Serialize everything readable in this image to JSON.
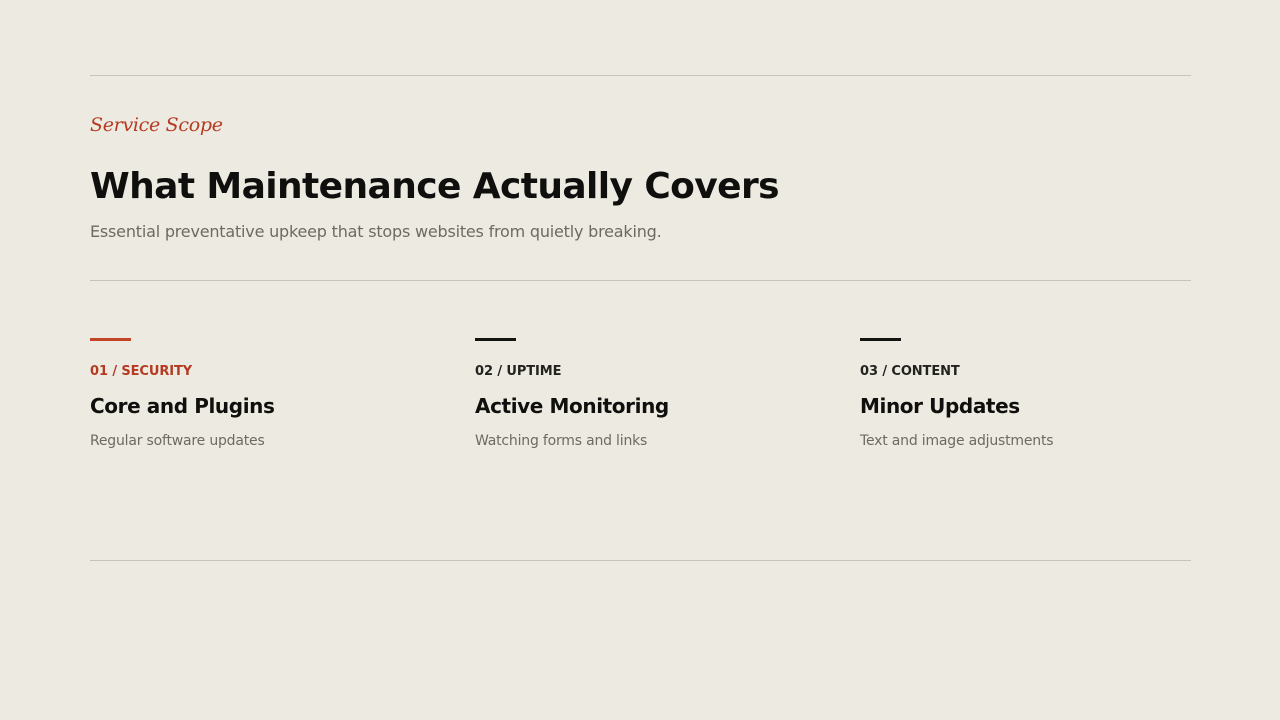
{
  "header": {
    "eyebrow": "Service Scope",
    "title": "What Maintenance Actually Covers",
    "subtitle": "Essential preventative upkeep that stops websites from quietly breaking."
  },
  "colors": {
    "background": "#EDEAE1",
    "accent": "#B53A22",
    "text": "#0F0F0D",
    "muted": "#6E6A62",
    "rule": "#C8C4BA"
  },
  "cards": [
    {
      "tag": "01 / SECURITY",
      "heading": "Core and Plugins",
      "description": "Regular software updates"
    },
    {
      "tag": "02 / UPTIME",
      "heading": "Active Monitoring",
      "description": "Watching forms and links"
    },
    {
      "tag": "03 / CONTENT",
      "heading": "Minor Updates",
      "description": "Text and image adjustments"
    }
  ]
}
